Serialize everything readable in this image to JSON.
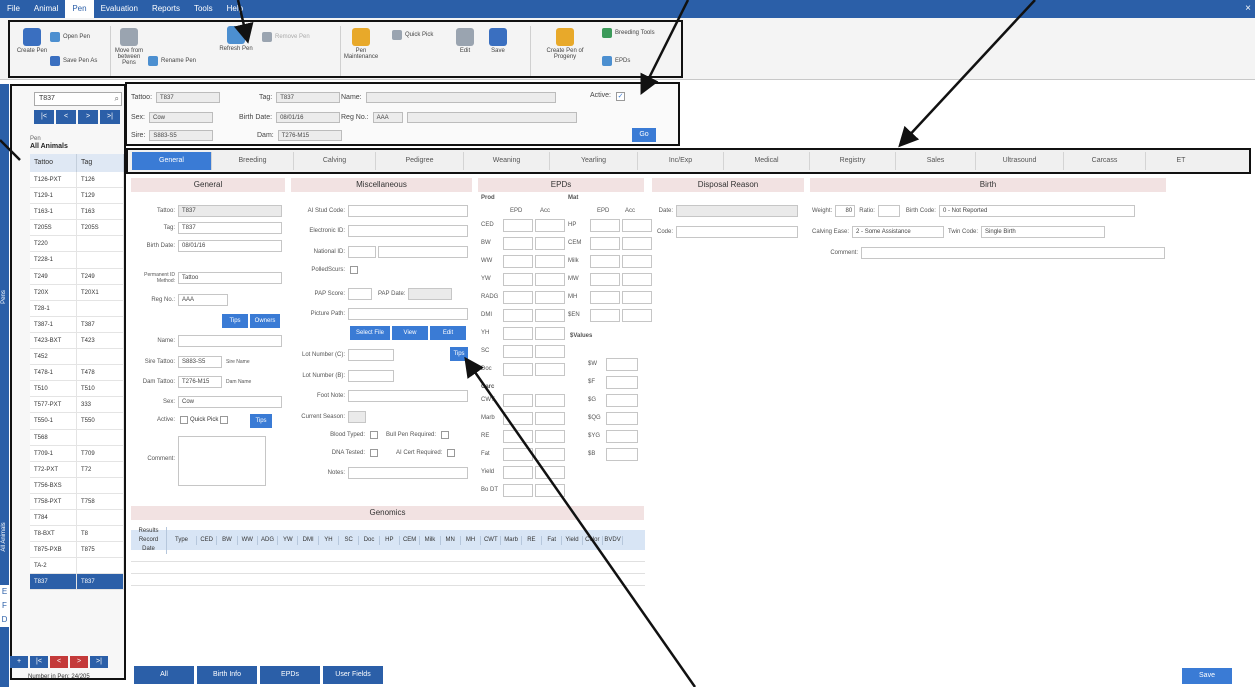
{
  "menu": {
    "items": [
      "File",
      "Animal",
      "Pen",
      "Evaluation",
      "Reports",
      "Tools",
      "Help"
    ],
    "active_index": 2,
    "close": "×"
  },
  "ribbon": {
    "buttons": [
      {
        "label": "Create Pen",
        "icon": "pen-p-icon"
      },
      {
        "label": "Open Pen",
        "icon": "open-folder-icon"
      },
      {
        "label": "Save Pen As",
        "icon": "save-icon"
      },
      {
        "label": "Move from between Pens",
        "icon": "move-animals-icon"
      },
      {
        "label": "Rename Pen",
        "icon": "rename-icon"
      },
      {
        "label": "Refresh Pen",
        "icon": "refresh-icon"
      },
      {
        "label": "Remove Pen",
        "icon": "remove-icon"
      },
      {
        "label": "Pen Maintenance",
        "icon": "maintenance-icon"
      },
      {
        "label": "Quick Pick",
        "icon": "quick-pick-icon"
      },
      {
        "label": "Edit",
        "icon": "edit-icon"
      },
      {
        "label": "Save",
        "icon": "save-icon"
      },
      {
        "label": "Create Pen of Progeny",
        "icon": "progeny-icon"
      },
      {
        "label": "Breeding Tools",
        "icon": "breeding-icon"
      },
      {
        "label": "EPDs",
        "icon": "epd-icon"
      }
    ]
  },
  "left_strip": {
    "label_pens": "Pens",
    "label_all": "All Animals"
  },
  "left_icons": [
    "E",
    "F",
    "D"
  ],
  "left_panel": {
    "search_value": "T837",
    "nav": [
      "|<",
      "<",
      ">",
      ">|"
    ],
    "pen_label": "Pen",
    "pen_name": "All Animals",
    "columns": [
      "Tattoo",
      "Tag"
    ],
    "rows": [
      [
        "T126-PXT",
        "T126"
      ],
      [
        "T129-1",
        "T129"
      ],
      [
        "T163-1",
        "T163"
      ],
      [
        "T205S",
        "T205S"
      ],
      [
        "T220",
        ""
      ],
      [
        "T228-1",
        ""
      ],
      [
        "T249",
        "T249"
      ],
      [
        "T20X",
        "T20X1"
      ],
      [
        "T28-1",
        ""
      ],
      [
        "T387-1",
        "T387"
      ],
      [
        "T423-BXT",
        "T423"
      ],
      [
        "T452",
        ""
      ],
      [
        "T478-1",
        "T478"
      ],
      [
        "T510",
        "T510"
      ],
      [
        "T577-PXT",
        "333"
      ],
      [
        "T550-1",
        "T550"
      ],
      [
        "T568",
        ""
      ],
      [
        "T709-1",
        "T709"
      ],
      [
        "T72-PXT",
        "T72"
      ],
      [
        "T756-BXS",
        ""
      ],
      [
        "T758-PXT",
        "T758"
      ],
      [
        "T784",
        ""
      ],
      [
        "T8-BXT",
        "T8"
      ],
      [
        "T875-PXB",
        "T875"
      ],
      [
        "TA-2",
        ""
      ],
      [
        "T837",
        "T837"
      ]
    ],
    "selected_row": 25,
    "bottom_nav": [
      "|<",
      "<",
      ">",
      ">|"
    ],
    "number_text": "Number in Pen: 24/205"
  },
  "header": {
    "tattoo_label": "Tattoo:",
    "tattoo_value": "T837",
    "tag_label": "Tag:",
    "tag_value": "T837",
    "name_label": "Name:",
    "name_value": "",
    "active_label": "Active:",
    "sex_label": "Sex:",
    "sex_value": "Cow",
    "birth_label": "Birth Date:",
    "birth_value": "08/01/16",
    "regno_label": "Reg No.:",
    "regno_prefix": "AAA",
    "regno_value": "",
    "sire_label": "Sire:",
    "sire_value": "S883-S5",
    "dam_label": "Dam:",
    "dam_value": "T276-M15",
    "go_label": "Go"
  },
  "tabs": [
    "General",
    "Breeding",
    "Calving",
    "Pedigree",
    "Weaning",
    "Yearling",
    "Inc/Exp",
    "Medical",
    "Registry",
    "Sales",
    "Ultrasound",
    "Carcass",
    "ET"
  ],
  "active_tab": 0,
  "general": {
    "title": "General",
    "tattoo_label": "Tattoo:",
    "tattoo_value": "T837",
    "tag_label": "Tag:",
    "tag_value": "T837",
    "birth_label": "Birth Date:",
    "birth_value": "08/01/16",
    "perm_label": "Permanent ID Method:",
    "perm_value": "Tattoo",
    "regno_label": "Reg No.:",
    "regno_value": "AAA",
    "tips_label": "Tips",
    "owners_label": "Owners",
    "name_label": "Name:",
    "name_value": "",
    "sire_label": "Sire Tattoo:",
    "sire_value": "S883-S5",
    "sire_note": "Sire Name",
    "dam_label": "Dam Tattoo:",
    "dam_value": "T276-M15",
    "dam_note": "Dam Name",
    "sex_label": "Sex:",
    "sex_value": "Cow",
    "active_label": "Active:",
    "quickpick_label": "Quick Pick",
    "tips2_label": "Tips",
    "comment_label": "Comment:"
  },
  "misc": {
    "title": "Miscellaneous",
    "ai_label": "AI Stud Code:",
    "elec_label": "Electronic ID:",
    "nat_label": "National ID:",
    "polled_label": "PolledScurs:",
    "pap_label": "PAP Score:",
    "papdate_label": "PAP Date:",
    "papdate_value": "",
    "pic_label": "Picture Path:",
    "select_label": "Select File",
    "view_label": "View",
    "edit_label": "Edit",
    "lote_label": "Lot Number (C):",
    "lotb_label": "Lot Number (B):",
    "treat_label": "Tips",
    "foot_label": "Foot Note:",
    "season_label": "Current Season:",
    "blood_label": "Blood Typed:",
    "bullpen_label": "Bull Pen Required:",
    "dna_label": "DNA Tested:",
    "ai_cert_label": "AI Cert Required:",
    "notes_label": "Notes:"
  },
  "epds": {
    "title": "EPDs",
    "prod_label": "Prod",
    "mat_label": "Mat",
    "epd_col": "EPD",
    "acc_col": "Acc",
    "prod_rows": [
      "CED",
      "BW",
      "WW",
      "YW",
      "RADG",
      "DMI",
      "YH",
      "SC",
      "Doc"
    ],
    "mat_rows": [
      "HP",
      "CEM",
      "Milk",
      "MW",
      "MH",
      "$EN"
    ],
    "carc_label": "Carc",
    "carc_rows": [
      "CWT",
      "Marb",
      "RE",
      "Fat",
      "Yield",
      "Bo DT"
    ],
    "index_label": "$Values",
    "index_rows": [
      "$W",
      "$F",
      "$G",
      "$QG",
      "$YG",
      "$B"
    ]
  },
  "disposal": {
    "title": "Disposal Reason",
    "date_label": "Date:",
    "code_label": "Code:"
  },
  "birth": {
    "title": "Birth",
    "weight_label": "Weight:",
    "weight_value": "80",
    "ratio_label": "Ratio:",
    "ratio_value": "",
    "code_label": "Birth Code:",
    "code_value": "0 - Not Reported",
    "ease_label": "Calving Ease:",
    "ease_value": "2 - Some Assistance",
    "twin_label": "Twin Code:",
    "twin_value": "Single Birth",
    "comment_label": "Comment:"
  },
  "genomics": {
    "title": "Genomics",
    "columns": [
      "Results Record Date",
      "Type",
      "CED",
      "BW",
      "WW",
      "ADG",
      "YW",
      "DMI",
      "YH",
      "SC",
      "Doc",
      "HP",
      "CEM",
      "Milk",
      "MN",
      "MH",
      "CWT",
      "Marb",
      "RE",
      "Fat",
      "Yield",
      "Color",
      "BVDV"
    ]
  },
  "bottom_tabs": [
    "All",
    "Birth Info",
    "EPDs",
    "User Fields"
  ],
  "save_label": "Save"
}
